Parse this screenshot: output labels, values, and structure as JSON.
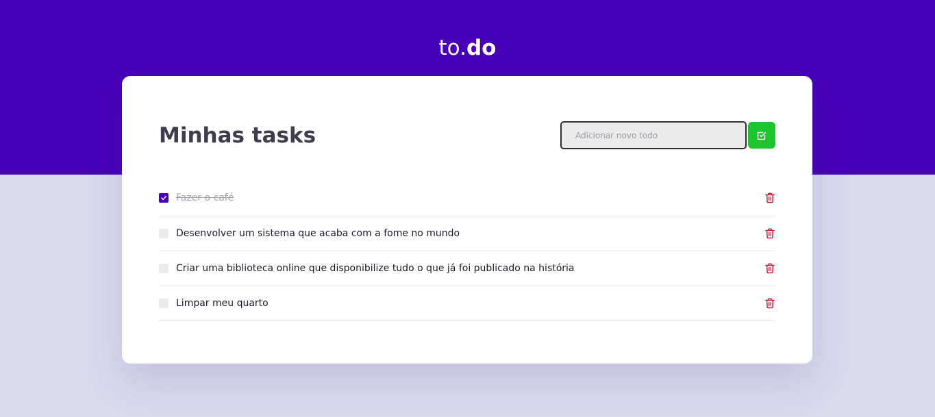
{
  "header": {
    "logo_light": "to.",
    "logo_bold": "do",
    "background_color": "#4700b8"
  },
  "main": {
    "title": "Minhas tasks",
    "new_todo": {
      "placeholder": "Adicionar novo todo",
      "value": ""
    },
    "add_button_icon": "check-square-icon",
    "add_button_color": "#1dc42d"
  },
  "tasks": [
    {
      "label": "Fazer o café",
      "completed": true
    },
    {
      "label": "Desenvolver um sistema que acaba com a fome no mundo",
      "completed": false
    },
    {
      "label": "Criar uma biblioteca online que disponibilize tudo o que já foi publicado na história",
      "completed": false
    },
    {
      "label": "Limpar meu quarto",
      "completed": false
    }
  ],
  "colors": {
    "accent": "#4700b8",
    "success": "#1dc42d",
    "danger": "#c8102e"
  },
  "icons": {
    "delete": "trash-icon",
    "checked": "check-icon"
  }
}
